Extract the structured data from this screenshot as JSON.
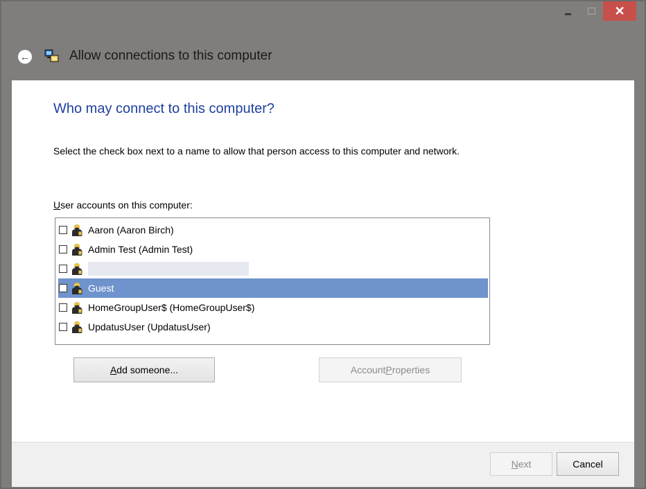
{
  "window": {
    "controls": {
      "minimize_icon": "minimize-icon",
      "maximize_icon": "maximize-icon",
      "close_glyph": "✕"
    }
  },
  "nav": {
    "back_glyph": "←",
    "title": "Allow connections to this computer"
  },
  "main": {
    "heading": "Who may connect to this computer?",
    "description": "Select the check box next to a name to allow that person access to this computer and network.",
    "list_label_accel": "U",
    "list_label_rest": "ser accounts on this computer:",
    "users": [
      {
        "name": "Aaron (Aaron Birch)",
        "checked": false,
        "selected": false
      },
      {
        "name": "Admin Test (Admin Test)",
        "checked": false,
        "selected": false
      },
      {
        "name": "",
        "checked": false,
        "selected": false,
        "redacted": true
      },
      {
        "name": "Guest",
        "checked": false,
        "selected": true
      },
      {
        "name": "HomeGroupUser$ (HomeGroupUser$)",
        "checked": false,
        "selected": false
      },
      {
        "name": "UpdatusUser (UpdatusUser)",
        "checked": false,
        "selected": false
      }
    ],
    "add_button_accel": "A",
    "add_button_rest": "dd someone...",
    "props_button_pre": "Account ",
    "props_button_accel": "P",
    "props_button_rest": "roperties"
  },
  "footer": {
    "next_accel": "N",
    "next_rest": "ext",
    "cancel_label": "Cancel"
  },
  "colors": {
    "heading": "#1e3f9e",
    "selection": "#6f93cc",
    "close": "#c7504a",
    "chrome": "#807e7c"
  }
}
